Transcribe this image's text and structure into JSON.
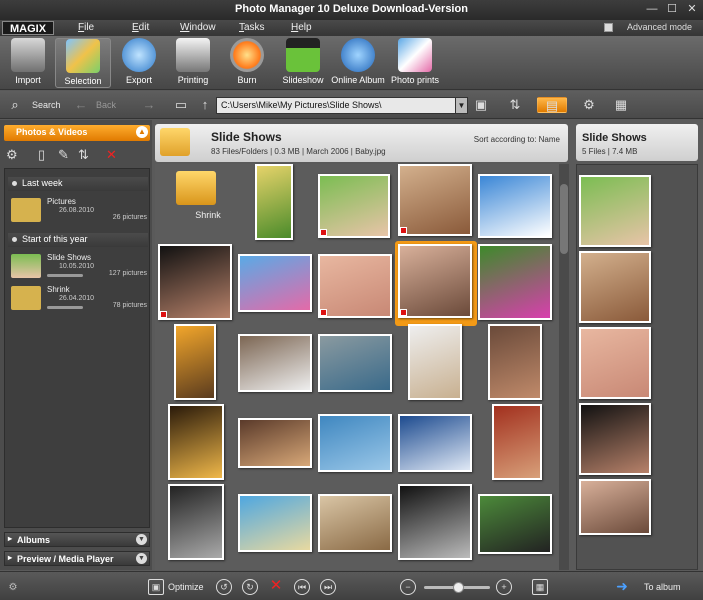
{
  "window": {
    "title": "Photo Manager 10 Deluxe Download-Version",
    "advanced_mode_label": "Advanced mode",
    "advanced_mode_checked": false
  },
  "menu": {
    "brand": "MAGIX",
    "items": [
      "File",
      "Edit",
      "Window",
      "Tasks",
      "Help"
    ]
  },
  "toolbar": {
    "items": [
      {
        "label": "Import",
        "icon": "camera-icon"
      },
      {
        "label": "Selection",
        "icon": "selection-grid-icon"
      },
      {
        "label": "Export",
        "icon": "export-globe-icon"
      },
      {
        "label": "Printing",
        "icon": "printer-icon"
      },
      {
        "label": "Burn",
        "icon": "burn-disc-icon"
      },
      {
        "label": "Slideshow",
        "icon": "slideshow-clapper-icon"
      },
      {
        "label": "Online Album",
        "icon": "online-album-globe-icon"
      },
      {
        "label": "Photo prints",
        "icon": "photo-prints-icon"
      }
    ],
    "active": "Selection"
  },
  "nav": {
    "search_label": "Search",
    "back_label": "Back",
    "path": "C:\\Users\\Mike\\My Pictures\\Slide Shows\\"
  },
  "left_panel": {
    "header": "Photos & Videos",
    "sections": [
      {
        "title": "Last week",
        "albums": [
          {
            "name": "Pictures",
            "date": "26.08.2010",
            "count": "26 pictures"
          }
        ]
      },
      {
        "title": "Start of this year",
        "albums": [
          {
            "name": "Slide Shows",
            "date": "10.05.2010",
            "count": "127 pictures"
          },
          {
            "name": "Shrink",
            "date": "26.04.2010",
            "count": "78 pictures"
          }
        ]
      }
    ],
    "footers": [
      "Albums",
      "Preview / Media Player"
    ]
  },
  "center": {
    "title": "Slide Shows",
    "subtitle": "83 Files/Folders  |  0.3 MB  |  March 2006  |  Baby.jpg",
    "sort_label": "Sort according to: Name",
    "folder_label": "Shrink",
    "photos": [
      {
        "desc": "sunset-field",
        "colors": [
          "#e6d36a",
          "#4a8b2a"
        ]
      },
      {
        "desc": "girl-smiling",
        "colors": [
          "#7bbd52",
          "#e8c4a8"
        ]
      },
      {
        "desc": "girl-portrait",
        "colors": [
          "#d3b08d",
          "#8a5a3a"
        ]
      },
      {
        "desc": "daisy-sky",
        "colors": [
          "#3a86d6",
          "#ffffff"
        ]
      },
      {
        "desc": "praying-girl",
        "colors": [
          "#111111",
          "#b8826a"
        ]
      },
      {
        "desc": "pink-flower-sky",
        "colors": [
          "#5aaae6",
          "#e46aa8"
        ]
      },
      {
        "desc": "baby-lips",
        "colors": [
          "#e8b7a0",
          "#c88875"
        ]
      },
      {
        "desc": "baby-face",
        "colors": [
          "#d8b09a",
          "#6b4a3a"
        ]
      },
      {
        "desc": "magenta-flower",
        "colors": [
          "#3d8a2a",
          "#d93fae"
        ]
      },
      {
        "desc": "sunset-sea",
        "colors": [
          "#f2a62b",
          "#5a3b1e"
        ]
      },
      {
        "desc": "white-rabbit",
        "colors": [
          "#7c6653",
          "#eeeeee"
        ]
      },
      {
        "desc": "river-rocks",
        "colors": [
          "#8a9aa0",
          "#3a6a8a"
        ]
      },
      {
        "desc": "toddler-white",
        "colors": [
          "#eeeeee",
          "#c8b090"
        ]
      },
      {
        "desc": "family-photo",
        "colors": [
          "#6a4a3a",
          "#c08a6a"
        ]
      },
      {
        "desc": "sunburst-tree",
        "colors": [
          "#2a1a0a",
          "#f0b84a"
        ]
      },
      {
        "desc": "group-party",
        "colors": [
          "#5a3a2a",
          "#d8a878"
        ]
      },
      {
        "desc": "skyscraper",
        "colors": [
          "#3f87c0",
          "#9ac7e8"
        ]
      },
      {
        "desc": "clouds-sunrays",
        "colors": [
          "#1d4b8f",
          "#dfe8f5"
        ]
      },
      {
        "desc": "couple-red",
        "colors": [
          "#a2301e",
          "#d8a07a"
        ]
      },
      {
        "desc": "bw-tree",
        "colors": [
          "#222222",
          "#aaaaaa"
        ]
      },
      {
        "desc": "tropical-beach",
        "colors": [
          "#4fa7e0",
          "#e8d9a0"
        ]
      },
      {
        "desc": "puppy",
        "colors": [
          "#d9c5a5",
          "#8a6a45"
        ]
      },
      {
        "desc": "bw-woman-face",
        "colors": [
          "#111111",
          "#bbbbbb"
        ]
      },
      {
        "desc": "dog-grass",
        "colors": [
          "#4c8a3a",
          "#222222"
        ]
      }
    ]
  },
  "right_panel": {
    "title": "Slide Shows",
    "subtitle": "5 Files  |  7.4 MB",
    "thumbs": [
      {
        "colors": [
          "#7bbd52",
          "#e8c4a8"
        ]
      },
      {
        "colors": [
          "#d3b08d",
          "#8a5a3a"
        ]
      },
      {
        "colors": [
          "#e8b7a0",
          "#c88875"
        ]
      },
      {
        "colors": [
          "#111111",
          "#b8826a"
        ]
      },
      {
        "colors": [
          "#d8b09a",
          "#6b4a3a"
        ]
      }
    ]
  },
  "bottom": {
    "optimize_label": "Optimize",
    "to_album_label": "To album",
    "zoom_level": 0.5
  },
  "colors": {
    "accent": "#f39a16",
    "mark_red": "#d11111"
  }
}
